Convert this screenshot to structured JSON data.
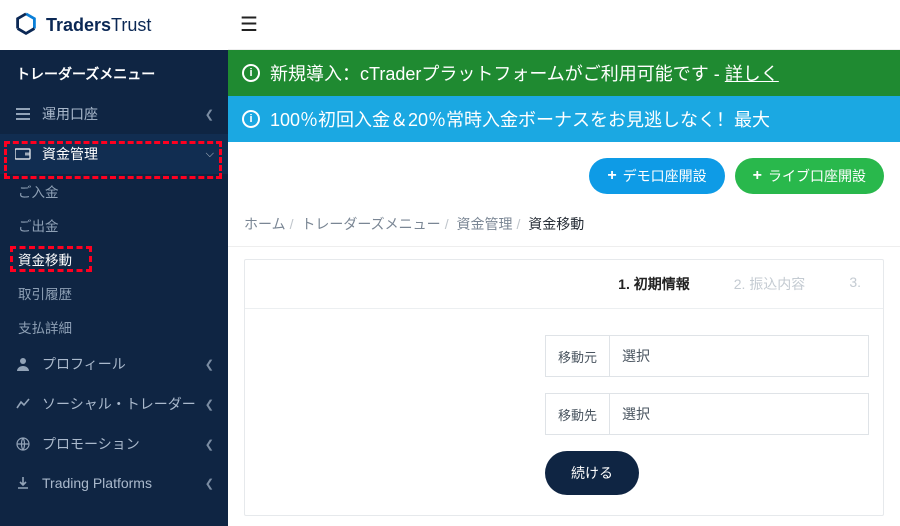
{
  "brand": {
    "strong": "Traders",
    "light": "Trust"
  },
  "sidebar": {
    "title": "トレーダーズメニュー",
    "items": [
      {
        "label": "運用口座",
        "icon": "list"
      },
      {
        "label": "資金管理",
        "icon": "wallet",
        "active": true,
        "sub": [
          {
            "label": "ご入金"
          },
          {
            "label": "ご出金"
          },
          {
            "label": "資金移動",
            "selected": true
          },
          {
            "label": "取引履歴"
          },
          {
            "label": "支払詳細"
          }
        ]
      },
      {
        "label": "プロフィール",
        "icon": "user"
      },
      {
        "label": "ソーシャル・トレーダー",
        "icon": "chart"
      },
      {
        "label": "プロモーション",
        "icon": "globe"
      },
      {
        "label": "Trading Platforms",
        "icon": "download"
      }
    ]
  },
  "banners": {
    "green_pre": "新規導入：cTraderプラットフォームがご利用可能です - ",
    "green_link": "詳しく",
    "blue": "100％初回入金＆20％常時入金ボーナスをお見逃しなく！最大"
  },
  "actions": {
    "demo": "デモ口座開設",
    "live": "ライブ口座開設"
  },
  "crumbs": {
    "a": "ホーム",
    "b": "トレーダーズメニュー",
    "c": "資金管理",
    "d": "資金移動"
  },
  "steps": {
    "s1": "1. 初期情報",
    "s2": "2. 振込内容",
    "s3": "3."
  },
  "form": {
    "from_label": "移動元",
    "from_value": "選択",
    "to_label": "移動先",
    "to_value": "選択",
    "continue": "続ける"
  }
}
